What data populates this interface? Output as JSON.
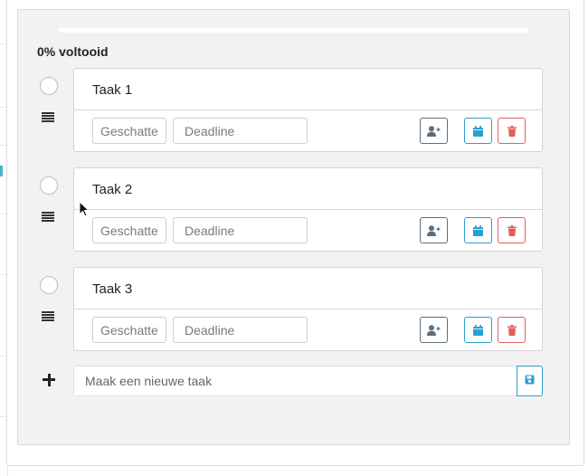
{
  "progress": {
    "label": "0% voltooid",
    "fraction": 0
  },
  "tasks": [
    {
      "title": "Taak 1",
      "estimate_placeholder": "Geschatte",
      "deadline_placeholder": "Deadline"
    },
    {
      "title": "Taak 2",
      "estimate_placeholder": "Geschatte",
      "deadline_placeholder": "Deadline"
    },
    {
      "title": "Taak 3",
      "estimate_placeholder": "Geschatte",
      "deadline_placeholder": "Deadline"
    }
  ],
  "new_task": {
    "placeholder": "Maak een nieuwe taak"
  },
  "icons": {
    "complete": "circle-checkbox-icon",
    "drag": "drag-handle-icon",
    "assign": "user-plus-icon",
    "date": "calendar-icon",
    "delete": "trash-icon",
    "add": "plus-icon",
    "save": "save-icon",
    "pointer": "mouse-pointer-icon"
  },
  "colors": {
    "accent": "#2a9fd0",
    "danger": "#e25e5e",
    "neutral": "#5b6f7c",
    "panel": "#f2f2f2"
  }
}
